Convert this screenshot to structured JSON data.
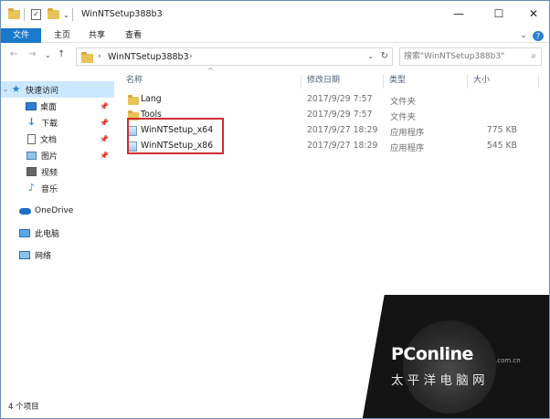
{
  "window": {
    "title": "WinNTSetup388b3",
    "minimize": "—",
    "maximize": "☐",
    "close": "✕"
  },
  "ribbon": {
    "tabs": [
      "文件",
      "主页",
      "共享",
      "查看"
    ],
    "expand": "⌄",
    "help": "?"
  },
  "nav": {
    "back": "←",
    "forward": "→",
    "recent": "⌄",
    "up": "↑",
    "breadcrumb": "WinNTSetup388b3",
    "search_placeholder": "搜索\"WinNTSetup388b3\""
  },
  "sidebar": {
    "items": [
      {
        "label": "快速访问",
        "icon": "star-icon"
      },
      {
        "label": "桌面",
        "icon": "desktop-icon"
      },
      {
        "label": "下载",
        "icon": "download-icon"
      },
      {
        "label": "文档",
        "icon": "document-icon"
      },
      {
        "label": "图片",
        "icon": "pictures-icon"
      },
      {
        "label": "视频",
        "icon": "videos-icon"
      },
      {
        "label": "音乐",
        "icon": "music-icon"
      },
      {
        "label": "OneDrive",
        "icon": "cloud-icon"
      },
      {
        "label": "此电脑",
        "icon": "computer-icon"
      },
      {
        "label": "网络",
        "icon": "network-icon"
      }
    ]
  },
  "columns": {
    "name": "名称",
    "date": "修改日期",
    "type": "类型",
    "size": "大小"
  },
  "files": [
    {
      "name": "Lang",
      "date": "2017/9/29 7:57",
      "type": "文件夹",
      "size": "",
      "icon": "folder-icon"
    },
    {
      "name": "Tools",
      "date": "2017/9/29 7:57",
      "type": "文件夹",
      "size": "",
      "icon": "folder-icon"
    },
    {
      "name": "WinNTSetup_x64",
      "date": "2017/9/27 18:29",
      "type": "应用程序",
      "size": "775 KB",
      "icon": "application-icon"
    },
    {
      "name": "WinNTSetup_x86",
      "date": "2017/9/27 18:29",
      "type": "应用程序",
      "size": "545 KB",
      "icon": "application-icon"
    }
  ],
  "status": {
    "count": "4 个项目"
  },
  "watermark": {
    "logo": "PConline",
    "domain": ".com.cn",
    "name": "太平洋电脑网"
  },
  "colors": {
    "accent": "#1979ca",
    "selection": "#cce8ff",
    "highlight": "#cc2f2f",
    "folder": "#e8c35a"
  }
}
